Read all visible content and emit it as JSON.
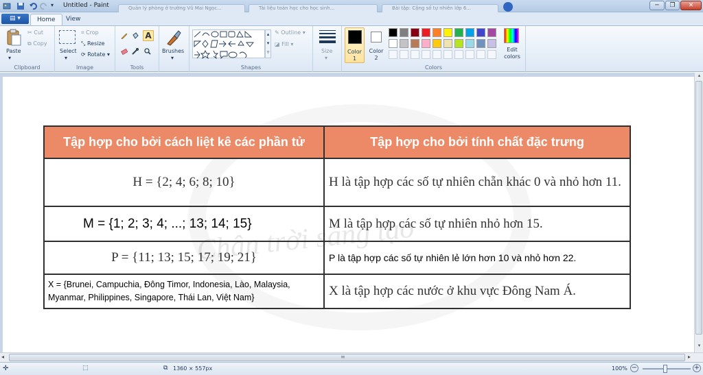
{
  "titlebar": {
    "title": "Untitled - Paint",
    "task_tabs": [
      "Quản lý phòng ở trường Vũ Mai Ngọc...",
      "Tài liệu toán học cho học sinh...",
      "Bài tập: Cộng số tự nhiên lớp 6..."
    ]
  },
  "tabs": {
    "file": "▤ ▾",
    "home": "Home",
    "view": "View"
  },
  "ribbon": {
    "clipboard": {
      "label": "Clipboard",
      "paste": "Paste",
      "cut": "Cut",
      "copy": "Copy"
    },
    "image": {
      "label": "Image",
      "select": "Select",
      "crop": "Crop",
      "resize": "Resize",
      "rotate": "Rotate ▾"
    },
    "tools": {
      "label": "Tools"
    },
    "brushes": {
      "label": "Brushes"
    },
    "shapes": {
      "label": "Shapes",
      "outline": "Outline ▾",
      "fill": "Fill ▾"
    },
    "size": {
      "label": "Size"
    },
    "colors": {
      "label": "Colors",
      "color1": "Color\n1",
      "color2": "Color\n2",
      "edit": "Edit\ncolors",
      "color1_value": "#000000",
      "color2_value": "#ffffff",
      "palette_row1": [
        "#000000",
        "#7f7f7f",
        "#880015",
        "#ed1c24",
        "#ff7f27",
        "#fff200",
        "#22b14c",
        "#00a2e8",
        "#3f48cc",
        "#a349a4"
      ],
      "palette_row2": [
        "#ffffff",
        "#c3c3c3",
        "#b97a57",
        "#ffaec9",
        "#ffc90e",
        "#efe4b0",
        "#b5e61d",
        "#99d9ea",
        "#7092be",
        "#c8bfe7"
      ]
    }
  },
  "table": {
    "header": [
      "Tập hợp cho bởi cách liệt kê các phần tử",
      "Tập hợp cho bởi tính chất đặc trưng"
    ],
    "rows": [
      {
        "left": "H = {2; 4; 6; 8; 10}",
        "right": "H là tập hợp các số tự nhiên chẵn khác 0 và nhỏ hơn 11."
      },
      {
        "left": "M = {1; 2; 3; 4; ...; 13; 14; 15}",
        "right": "M là tập hợp các số tự nhiên nhỏ hơn 15."
      },
      {
        "left": "P = {11; 13; 15; 17; 19; 21}",
        "right": "P là tập hợp các số tự nhiên lẻ lớn hơn 10 và nhỏ hơn 22."
      },
      {
        "left": "X = {Brunei, Campuchia, Đông Timor, Indonesia, Lào, Malaysia, Myanmar, Philippines, Singapore, Thái Lan, Việt Nam}",
        "right": "X là tập hợp các nước ở khu vực Đông Nam Á."
      }
    ],
    "watermark": "Chân trời sáng tạo"
  },
  "statusbar": {
    "size": "1360 × 557px",
    "zoom": "100%"
  }
}
